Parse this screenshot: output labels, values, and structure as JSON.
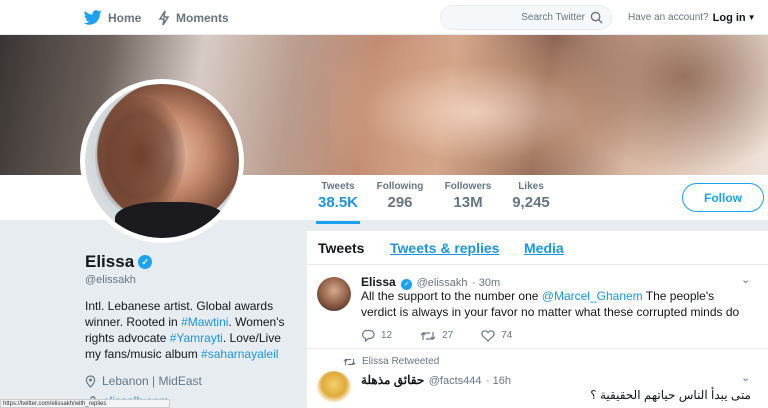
{
  "nav": {
    "home_label": "Home",
    "moments_label": "Moments",
    "search_placeholder": "Search Twitter",
    "account_prompt": "Have an account?",
    "login_label": "Log in"
  },
  "stats": [
    {
      "label": "Tweets",
      "value": "38.5K"
    },
    {
      "label": "Following",
      "value": "296"
    },
    {
      "label": "Followers",
      "value": "13M"
    },
    {
      "label": "Likes",
      "value": "9,245"
    }
  ],
  "follow_label": "Follow",
  "profile": {
    "name": "Elissa",
    "handle": "@elissakh",
    "bio_1": "Intl. Lebanese artist. Global awards winner. Rooted in ",
    "bio_tag_1": "#Mawtini",
    "bio_2": ". Women's rights advocate ",
    "bio_tag_2": "#Yamrayti",
    "bio_3": ". Love/Live my fans/music album ",
    "bio_tag_3": "#saharnayaleil",
    "location": "Lebanon | MidEast",
    "url": "elissalb.com"
  },
  "tabs": [
    "Tweets",
    "Tweets & replies",
    "Media"
  ],
  "tweets": [
    {
      "name": "Elissa",
      "handle": "@elissakh",
      "time": "· 30m",
      "text_1": "All the support to the number one ",
      "mention": "@Marcel_Ghanem",
      "text_2": " The people's verdict is always in your favor no matter what these corrupted minds do",
      "replies": "12",
      "retweets": "27",
      "likes": "74"
    },
    {
      "retweeted_by": "Elissa Retweeted",
      "name": "حقائق مذهلة",
      "handle": "@facts444",
      "time": "· 16h",
      "text": "متى يبدأ الناس حياتهم الحقيقية ؟"
    }
  ],
  "status_url": "https://twitter.com/elissakh/with_replies",
  "colors": {
    "accent": "#1da1f2",
    "link": "#1b95e0",
    "background": "#e6ecf0"
  }
}
